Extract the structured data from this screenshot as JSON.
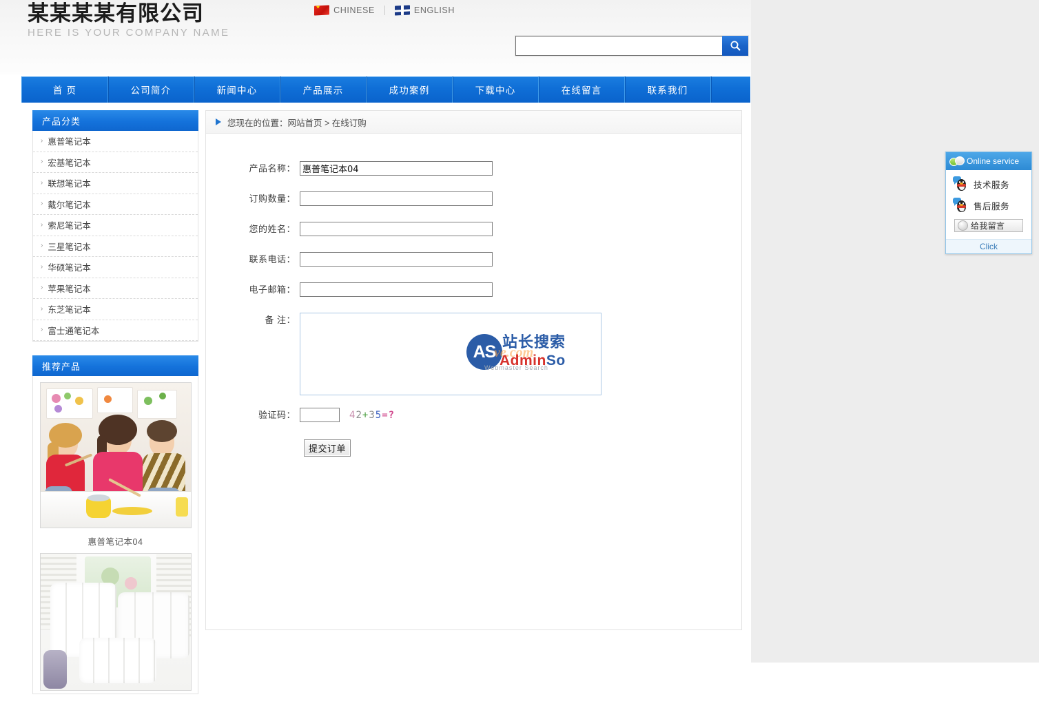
{
  "header": {
    "logo_cn": "某某某某有限公司",
    "logo_en": "HERE IS YOUR COMPANY NAME",
    "lang_cn": "CHINESE",
    "lang_en": "ENGLISH",
    "search_value": "",
    "search_placeholder": "",
    "search_icon": "search-icon"
  },
  "nav": {
    "items": [
      {
        "label": "首 页"
      },
      {
        "label": "公司简介"
      },
      {
        "label": "新闻中心"
      },
      {
        "label": "产品展示"
      },
      {
        "label": "成功案例"
      },
      {
        "label": "下载中心"
      },
      {
        "label": "在线留言"
      },
      {
        "label": "联系我们"
      }
    ]
  },
  "sidebar": {
    "category_panel_title": "产品分类",
    "categories": [
      {
        "label": "惠普笔记本"
      },
      {
        "label": "宏基笔记本"
      },
      {
        "label": "联想笔记本"
      },
      {
        "label": "戴尔笔记本"
      },
      {
        "label": "索尼笔记本"
      },
      {
        "label": "三星笔记本"
      },
      {
        "label": "华硕笔记本"
      },
      {
        "label": "苹果笔记本"
      },
      {
        "label": "东芝笔记本"
      },
      {
        "label": "富士通笔记本"
      }
    ],
    "recommend_panel_title": "推荐产品",
    "products": [
      {
        "caption": "惠普笔记本04"
      },
      {
        "caption": ""
      }
    ]
  },
  "main": {
    "breadcrumb": "您现在的位置：网站首页 > 在线订购",
    "form": {
      "rows": [
        {
          "label": "产品名称：",
          "value": "惠普笔记本04"
        },
        {
          "label": "订购数量：",
          "value": ""
        },
        {
          "label": "您的姓名：",
          "value": ""
        },
        {
          "label": "联系电话：",
          "value": ""
        },
        {
          "label": "电子邮箱：",
          "value": ""
        }
      ],
      "memo_label": "备 注：",
      "memo_value": "",
      "captcha_label": "验证码：",
      "captcha_value": "",
      "captcha_question": "42+35=?",
      "captcha_chars": [
        "4",
        "2",
        "+",
        "3",
        "5",
        "=",
        "?"
      ],
      "submit_label": "提交订单"
    }
  },
  "watermark": {
    "badge": "AS",
    "cn": "站长搜索",
    "domain": "ve.com",
    "brand_red": "Admin",
    "brand_blue": "So",
    "tagline": "Webmaster Search"
  },
  "online_service": {
    "title": "Online service",
    "items": [
      {
        "label": "技术服务"
      },
      {
        "label": "售后服务"
      }
    ],
    "message_label": "给我留言",
    "footer_label": "Click"
  },
  "colors": {
    "brand_blue": "#0f6ed6",
    "nav_blue": "#1a7de0",
    "panel_blue": "#1472db",
    "watermark_blue": "#1a4fa0",
    "watermark_red": "#d4211b"
  }
}
